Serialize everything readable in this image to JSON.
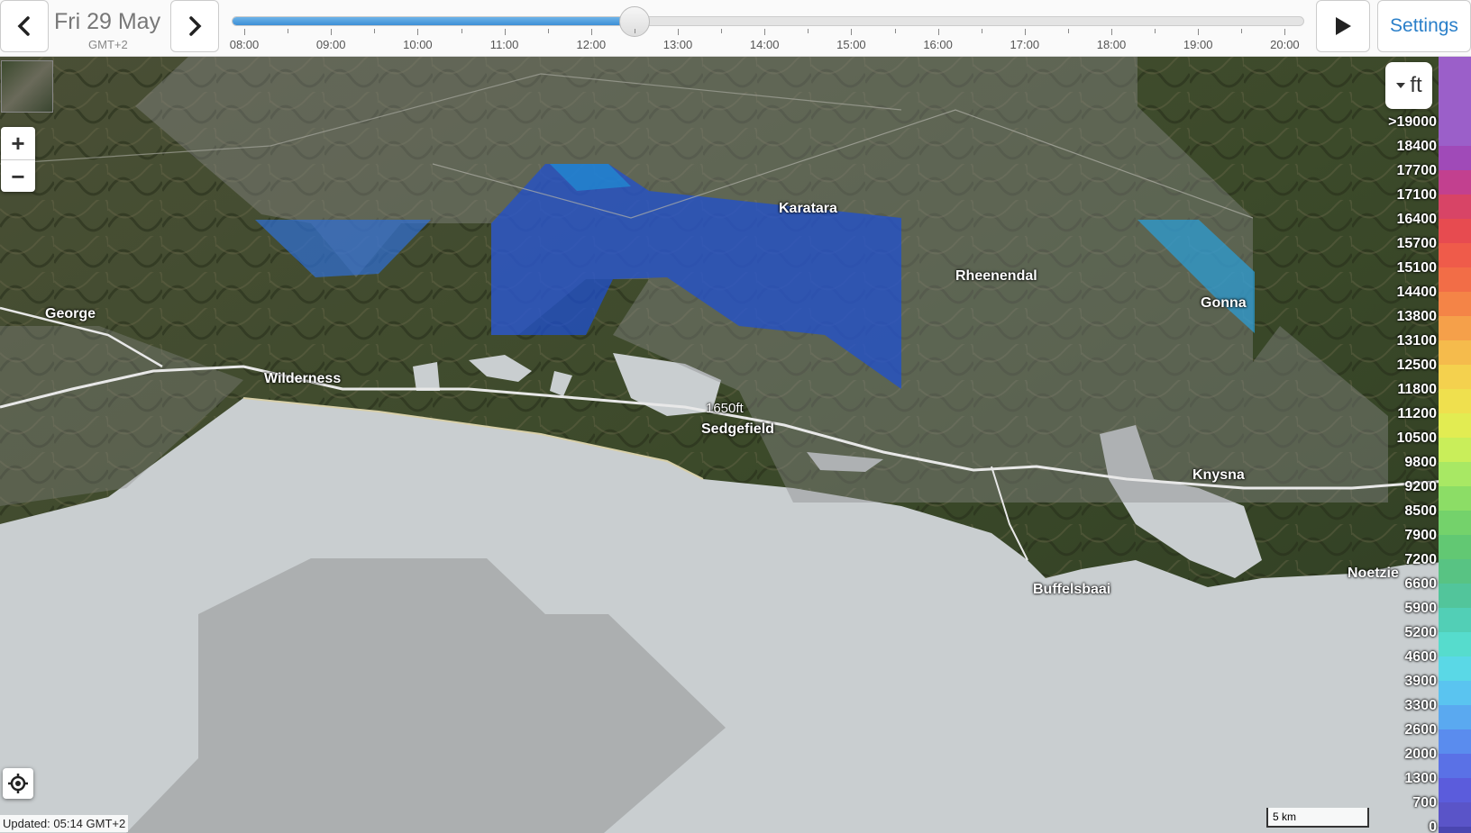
{
  "topbar": {
    "date": "Fri 29 May",
    "timezone": "GMT+2",
    "prev_icon": "chevron-left-icon",
    "next_icon": "chevron-right-icon",
    "play_icon": "play-icon",
    "settings_label": "Settings",
    "timeline": {
      "hours": [
        "08:00",
        "09:00",
        "10:00",
        "11:00",
        "12:00",
        "13:00",
        "14:00",
        "15:00",
        "16:00",
        "17:00",
        "18:00",
        "19:00",
        "20:00"
      ],
      "current": "12:30",
      "progress": 0.375
    }
  },
  "map": {
    "places": [
      "George",
      "Wilderness",
      "Karatara",
      "Rheenendal",
      "Gonna",
      "Sedgefield",
      "Knysna",
      "Buffelsbaai",
      "Noetzie"
    ],
    "spot_label": "1650ft",
    "zoom_in": "+",
    "zoom_out": "−",
    "updated": "Updated: 05:14 GMT+2",
    "scale": "5 km"
  },
  "legend": {
    "unit": "ft",
    "values": [
      ">19000",
      "18400",
      "17700",
      "17100",
      "16400",
      "15700",
      "15100",
      "14400",
      "13800",
      "13100",
      "12500",
      "11800",
      "11200",
      "10500",
      "9800",
      "9200",
      "8500",
      "7900",
      "7200",
      "6600",
      "5900",
      "5200",
      "4600",
      "3900",
      "3300",
      "2600",
      "2000",
      "1300",
      "700",
      "0"
    ],
    "colors": [
      "#9b5fc9",
      "#a04ab8",
      "#c2408f",
      "#d84466",
      "#e74b50",
      "#ef5b4a",
      "#f26d47",
      "#f48447",
      "#f5a04a",
      "#f5bb4c",
      "#f4d14e",
      "#efe04e",
      "#e2ec52",
      "#c9ee5a",
      "#a8e864",
      "#8cdd66",
      "#74d26b",
      "#62c873",
      "#58c383",
      "#52c59b",
      "#52cfb6",
      "#56dccd",
      "#5ad8e6",
      "#5ac4f0",
      "#5aa9f0",
      "#5a8cee",
      "#5a71e6",
      "#5b5cdc",
      "#5a54c8",
      "#4a46b0"
    ]
  }
}
